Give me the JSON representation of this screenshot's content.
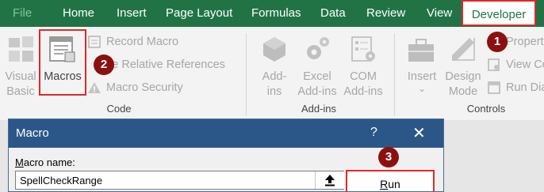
{
  "tabs": {
    "file": "File",
    "home": "Home",
    "insert": "Insert",
    "page_layout": "Page Layout",
    "formulas": "Formulas",
    "data": "Data",
    "review": "Review",
    "view": "View",
    "developer": "Developer"
  },
  "ribbon": {
    "code": {
      "visual_basic_l1": "Visual",
      "visual_basic_l2": "Basic",
      "macros": "Macros",
      "record_macro": "Record Macro",
      "relative_refs": "se Relative References",
      "macro_security": "Macro Security",
      "group": "Code"
    },
    "addins": {
      "addins_l1": "Add-",
      "addins_l2": "ins",
      "excel_addins_l1": "Excel",
      "excel_addins_l2": "Add-ins",
      "com_addins_l1": "COM",
      "com_addins_l2": "Add-ins",
      "group": "Add-ins"
    },
    "controls": {
      "insert_label": "Insert",
      "insert_chevron": "⌄",
      "design_mode_l1": "Design",
      "design_mode_l2": "Mode",
      "properties": "Propert",
      "view_code": "View Co",
      "run_dialog": "Run Dia",
      "group": "Controls"
    }
  },
  "badges": {
    "b1": "1",
    "b2": "2",
    "b3": "3"
  },
  "dialog": {
    "title": "Macro",
    "help": "?",
    "close": "✕",
    "macro_name_label_rest": "acro name:",
    "macro_name_label_u": "M",
    "macro_name_value": "SpellCheckRange",
    "run_u": "R",
    "run_rest": "un"
  },
  "colors": {
    "excel_green": "#217346",
    "highlight_red": "#e02828",
    "badge": "#8c1010",
    "dialog_title": "#2b5788"
  }
}
